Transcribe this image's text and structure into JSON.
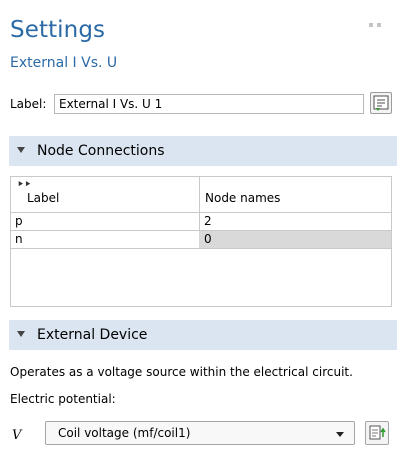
{
  "header": {
    "title": "Settings",
    "subtitle": "External I Vs. U"
  },
  "label_field": {
    "label": "Label:",
    "value": "External I Vs. U 1",
    "button_icon": "text-edit-icon"
  },
  "node_connections": {
    "title": "Node Connections",
    "columns": [
      "Label",
      "Node names"
    ],
    "rows": [
      {
        "label": "p",
        "node": "2"
      },
      {
        "label": "n",
        "node": "0"
      }
    ]
  },
  "external_device": {
    "title": "External Device",
    "description": "Operates as a voltage source within the electrical circuit.",
    "potential_label": "Electric potential:",
    "symbol": "V",
    "selected_value": "Coil voltage (mf/coil1)",
    "side_button_icon": "go-to-source-icon"
  },
  "colors": {
    "accent": "#2b6aa6",
    "section_bg": "#dae5f1"
  }
}
